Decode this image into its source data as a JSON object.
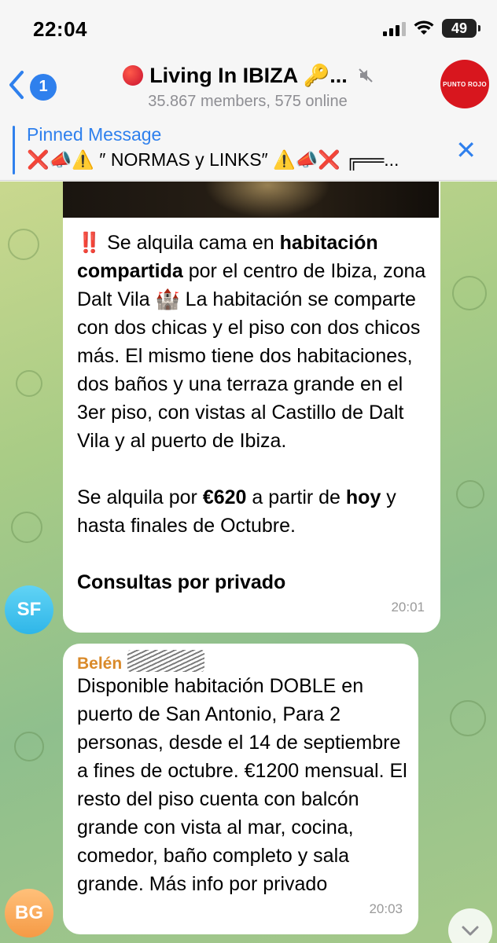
{
  "status_bar": {
    "time": "22:04",
    "battery": "49"
  },
  "header": {
    "back_count": "1",
    "title": "Living In IBIZA 🔑...",
    "subtitle": "35.867 members, 575 online",
    "avatar_text": "PUNTO ROJO"
  },
  "pinned": {
    "title": "Pinned Message",
    "text": "❌📣⚠️ ″ NORMAS y LINKS″ ⚠️📣❌ ╔══..."
  },
  "messages": [
    {
      "avatar_initials": "SF",
      "time": "20:01",
      "lines": [
        "‼️ Se alquila cama en ",
        "habitación compartida",
        " por el centro de Ibiza, zona Dalt Vila 🏰 La habitación se comparte con dos chicas y el piso con dos chicos más. El mismo tiene dos habitaciones, dos baños y una terraza grande en el 3er piso, con vistas al Castillo de Dalt Vila y al puerto de Ibiza.",
        "Se alquila por ",
        "€620",
        " a partir de ",
        "hoy",
        " y hasta finales de Octubre.",
        "Consultas por privado"
      ]
    },
    {
      "avatar_initials": "BG",
      "sender": "Belén",
      "time": "20:03",
      "text": "Disponible habitación DOBLE en puerto de San Antonio, Para 2 personas, desde el 14 de septiembre a fines de octubre. €1200 mensual. El resto del piso cuenta con balcón grande con vista al mar, cocina, comedor, baño completo y sala grande. Más info por privado"
    }
  ],
  "colors": {
    "accent": "#2f80ed",
    "sender_name": "#d98a2a",
    "avatar_sf": "#2fb6e8",
    "avatar_bg": "#f59a45",
    "channel_avatar": "#d8161e"
  },
  "icons": {
    "back": "chevron-left-icon",
    "mute": "muted-speaker-icon",
    "close": "close-icon",
    "scroll": "chevron-down-icon"
  }
}
